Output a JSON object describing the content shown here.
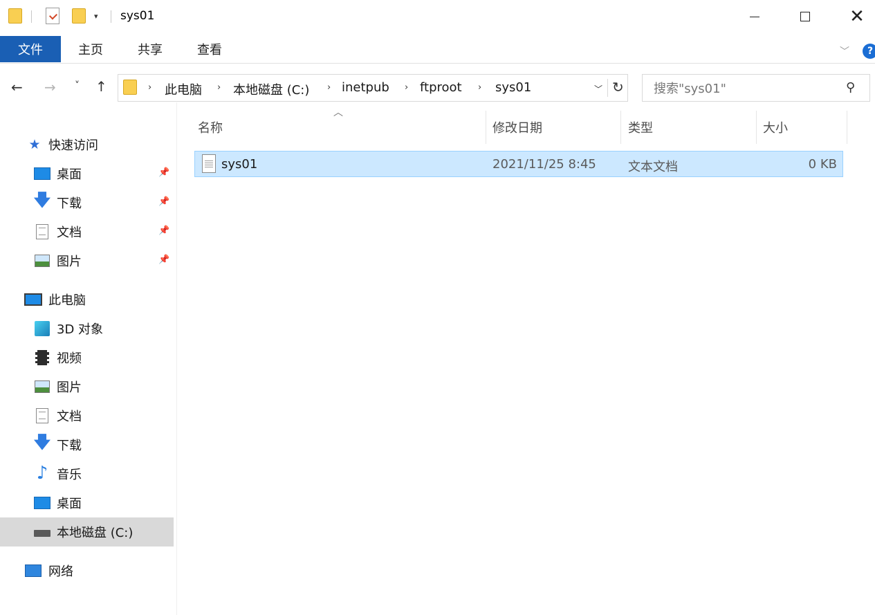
{
  "window": {
    "title": "sys01",
    "qa_dropdown": "▾"
  },
  "ribbon": {
    "tabs": [
      "文件",
      "主页",
      "共享",
      "查看"
    ],
    "help": "?"
  },
  "nav": {
    "back": "←",
    "forward": "→",
    "recent": "˅",
    "up": "↑",
    "breadcrumb": [
      "此电脑",
      "本地磁盘 (C:)",
      "inetpub",
      "ftproot",
      "sys01"
    ],
    "search_placeholder": "搜索\"sys01\""
  },
  "sidebar": {
    "quick_access": {
      "label": "快速访问",
      "items": [
        {
          "label": "桌面",
          "icon": "desktop-icon"
        },
        {
          "label": "下载",
          "icon": "download-icon"
        },
        {
          "label": "文档",
          "icon": "document-icon"
        },
        {
          "label": "图片",
          "icon": "picture-icon"
        }
      ]
    },
    "this_pc": {
      "label": "此电脑",
      "items": [
        {
          "label": "3D 对象",
          "icon": "3d-objects-icon"
        },
        {
          "label": "视频",
          "icon": "video-icon"
        },
        {
          "label": "图片",
          "icon": "picture-icon"
        },
        {
          "label": "文档",
          "icon": "document-icon"
        },
        {
          "label": "下载",
          "icon": "download-icon"
        },
        {
          "label": "音乐",
          "icon": "music-icon"
        },
        {
          "label": "桌面",
          "icon": "desktop-icon"
        },
        {
          "label": "本地磁盘 (C:)",
          "icon": "drive-icon",
          "selected": true
        }
      ]
    },
    "network": {
      "label": "网络",
      "icon": "network-icon"
    }
  },
  "columns": {
    "name": "名称",
    "modified": "修改日期",
    "type": "类型",
    "size": "大小"
  },
  "files": [
    {
      "name": "sys01",
      "modified": "2021/11/25 8:45",
      "type": "文本文档",
      "size": "0 KB",
      "selected": true
    }
  ]
}
